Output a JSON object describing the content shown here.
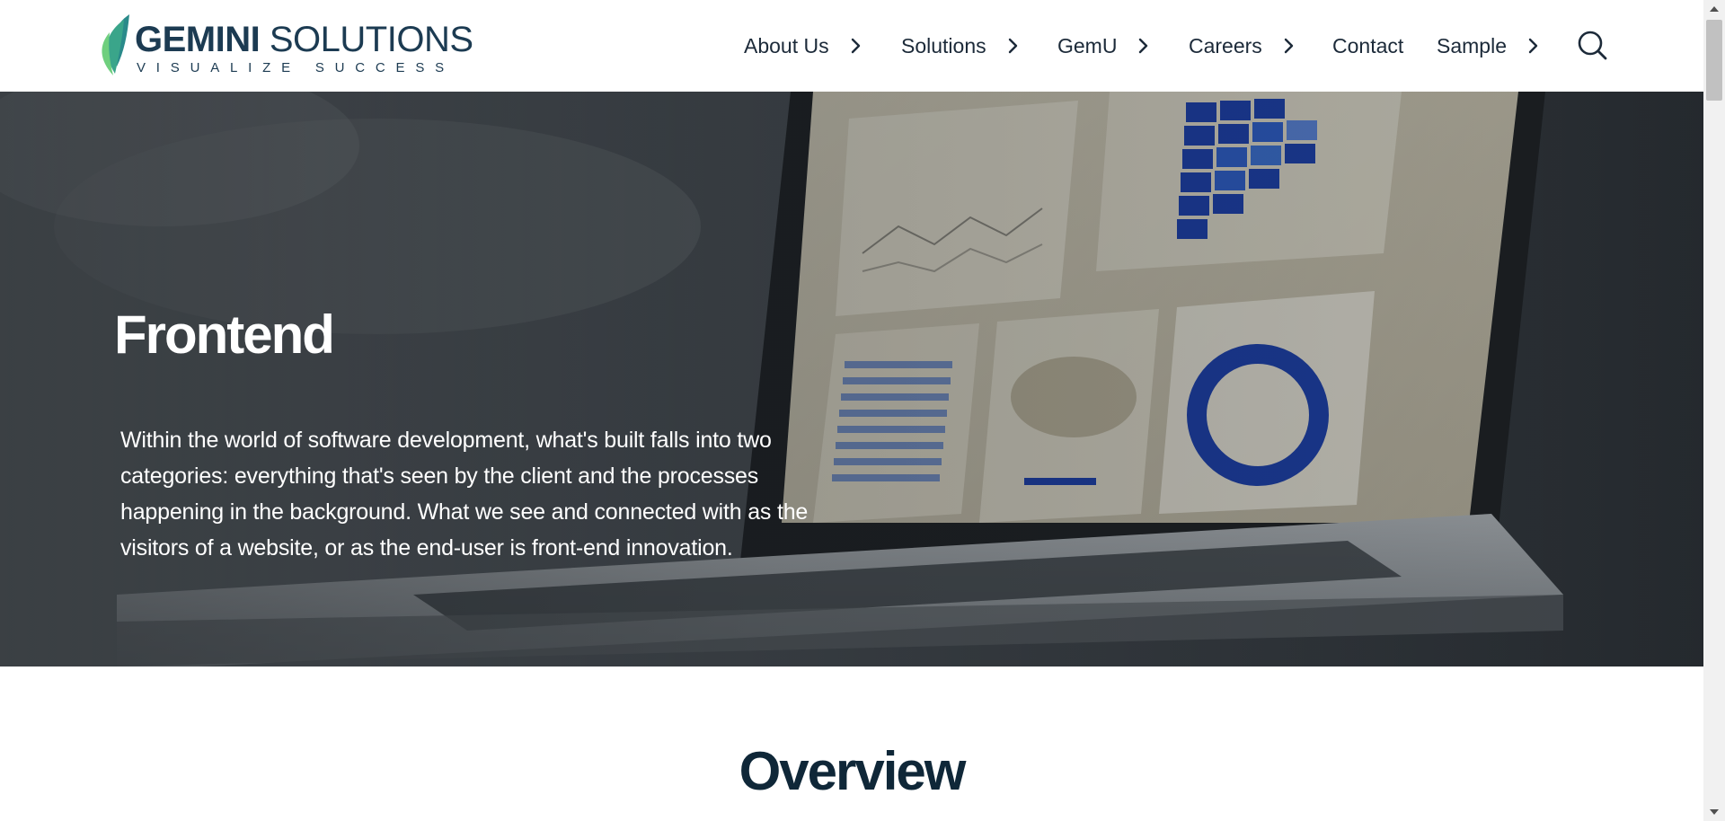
{
  "brand": {
    "name_bold": "GEMINI",
    "name_light": "SOLUTIONS",
    "tagline": "VISUALIZE SUCCESS",
    "colors": {
      "navy": "#1c3b52",
      "leaf_green": "#5cc07a",
      "leaf_teal": "#2a8a8a"
    }
  },
  "nav": {
    "items": [
      {
        "label": "About Us",
        "has_submenu": true
      },
      {
        "label": "Solutions",
        "has_submenu": true
      },
      {
        "label": "GemU",
        "has_submenu": true
      },
      {
        "label": "Careers",
        "has_submenu": true
      },
      {
        "label": "Contact",
        "has_submenu": false
      },
      {
        "label": "Sample",
        "has_submenu": true
      }
    ],
    "search_icon": "search-icon",
    "chevron_icon": "chevron-right-icon"
  },
  "hero": {
    "title": "Frontend",
    "description": "Within the world of software development, what's built falls into two categories: everything that's seen by the client and the processes happening in the background. What we see and connected with as the visitors of a website, or as the end-user is front-end innovation."
  },
  "overview": {
    "title": "Overview"
  },
  "colors": {
    "text_dark": "#1c2a39",
    "heading_dark": "#0f2738",
    "hero_text": "#ffffff"
  }
}
